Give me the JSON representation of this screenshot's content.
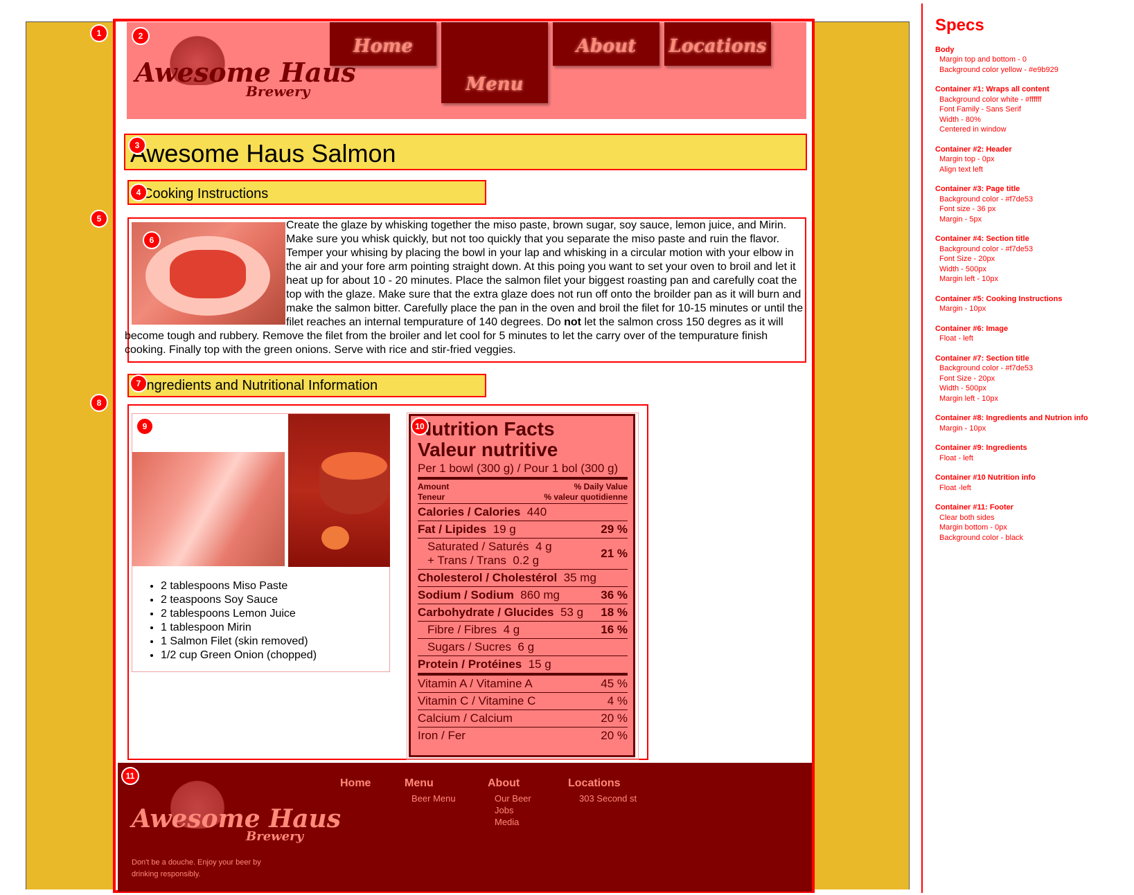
{
  "nav": {
    "home": "Home",
    "menu": "Menu",
    "about": "About",
    "locations": "Locations"
  },
  "logo": {
    "line1": "Awesome Haus",
    "line2": "Brewery"
  },
  "page_title": "Awesome Haus Salmon",
  "section_cooking": "Cooking Instructions",
  "section_ingredients": "Ingredients and Nutritional Information",
  "cooking_text_1": "Create the glaze by whisking together the miso paste, brown sugar, soy sauce, lemon juice, and Mirin. Make sure you whisk quickly, but not too quickly that you separate the miso paste and ruin the flavor. Temper your whising by placing the bowl in your lap and whisking in a circular motion with your elbow in the air and your fore arm pointing straight down. At this poing you want to set your oven to broil and let it heat up for about 10 - 20 minutes. Place the salmon filet your biggest roasting pan and carefully coat the top with the glaze. Make sure that the extra glaze does not run off onto the broilder pan as it will burn and make the salmon bitter. Carefully place the pan in the oven and broil the filet for 10-15 minutes or until the filet reaches an internal tempurature of 140 degrees. Do ",
  "cooking_text_bold": "not",
  "cooking_text_2": " let the salmon cross 150 degres as it will become tough and rubbery. Remove the filet from the broiler and let cool for 5 minutes to let the carry over of the tempurature finish cooking. Finally top with the green onions. Serve with rice and stir-fried veggies.",
  "ingredients": [
    "2 tablespoons Miso Paste",
    "2 teaspoons Soy Sauce",
    "2 tablespoons Lemon Juice",
    "1 tablespoon Mirin",
    "1 Salmon Filet (skin removed)",
    "1/2 cup Green Onion (chopped)"
  ],
  "nutrition": {
    "title1": "Nutrition Facts",
    "title2": "Valeur nutritive",
    "per": "Per 1 bowl (300 g) / Pour 1 bol (300 g)",
    "amount": "Amount",
    "teneur": "Teneur",
    "dv": "% Daily Value",
    "dv_fr": "% valeur quotidienne",
    "rows": [
      {
        "label": "Calories / Calories",
        "amount": "440",
        "dv": ""
      },
      {
        "label": "Fat / Lipides",
        "amount": "19 g",
        "dv": "29 %"
      },
      {
        "label": "Saturated / Saturés",
        "amount": "4 g",
        "dv": "21 %"
      },
      {
        "label": "+ Trans / Trans",
        "amount": "0.2 g",
        "dv": ""
      },
      {
        "label": "Cholesterol / Cholestérol",
        "amount": "35 mg",
        "dv": ""
      },
      {
        "label": "Sodium / Sodium",
        "amount": "860 mg",
        "dv": "36 %"
      },
      {
        "label": "Carbohydrate / Glucides",
        "amount": "53 g",
        "dv": "18 %"
      },
      {
        "label": "Fibre / Fibres",
        "amount": "4 g",
        "dv": "16 %"
      },
      {
        "label": "Sugars / Sucres",
        "amount": "6 g",
        "dv": ""
      },
      {
        "label": "Protein / Protéines",
        "amount": "15 g",
        "dv": ""
      },
      {
        "label": "Vitamin A / Vitamine A",
        "amount": "",
        "dv": "45 %"
      },
      {
        "label": "Vitamin C / Vitamine C",
        "amount": "",
        "dv": "4 %"
      },
      {
        "label": "Calcium / Calcium",
        "amount": "",
        "dv": "20 %"
      },
      {
        "label": "Iron / Fer",
        "amount": "",
        "dv": "20 %"
      }
    ]
  },
  "footer": {
    "home": "Home",
    "menu": "Menu",
    "about": "About",
    "locations": "Locations",
    "beer_menu": "Beer Menu",
    "our_beer": "Our Beer",
    "jobs": "Jobs",
    "media": "Media",
    "address": "303 Second st",
    "tagline_1": "Don't be a douche. Enjoy your beer by",
    "tagline_2": "drinking responsibly."
  },
  "markers": [
    "1",
    "2",
    "3",
    "4",
    "5",
    "6",
    "7",
    "8",
    "9",
    "10",
    "11"
  ],
  "specs": {
    "title": "Specs",
    "blocks": [
      {
        "t": "Body",
        "l": [
          "Margin top and bottom - 0",
          "Background color yellow - #e9b929"
        ]
      },
      {
        "t": "Container #1: Wraps all content",
        "l": [
          "Background color white - #ffffff",
          "Font Family - Sans Serif",
          "Width - 80%",
          "Centered in window"
        ]
      },
      {
        "t": "Container #2: Header",
        "l": [
          "Margin top - 0px",
          "Align text left"
        ]
      },
      {
        "t": "Container #3: Page title",
        "l": [
          "Background color - #f7de53",
          "Font size - 36 px",
          "Margin - 5px"
        ]
      },
      {
        "t": "Container #4: Section title",
        "l": [
          "Background color - #f7de53",
          "Font Size - 20px",
          "Width - 500px",
          "Margin left - 10px"
        ]
      },
      {
        "t": "Container #5: Cooking Instructions",
        "l": [
          "Margin - 10px"
        ]
      },
      {
        "t": "Container #6: Image",
        "l": [
          "Float - left"
        ]
      },
      {
        "t": "Container #7: Section title",
        "l": [
          "Background color - #f7de53",
          "Font Size - 20px",
          "Width - 500px",
          "Margin left - 10px"
        ]
      },
      {
        "t": "Container #8: Ingredients and Nutrion info",
        "l": [
          "Margin - 10px"
        ]
      },
      {
        "t": "Container #9: Ingredients",
        "l": [
          "Float - left"
        ]
      },
      {
        "t": "Container #10 Nutrition info",
        "l": [
          "Float -left"
        ]
      },
      {
        "t": "Container #11: Footer",
        "l": [
          "Clear both sides",
          "Margin bottom - 0px",
          "Background color - black"
        ]
      }
    ]
  }
}
